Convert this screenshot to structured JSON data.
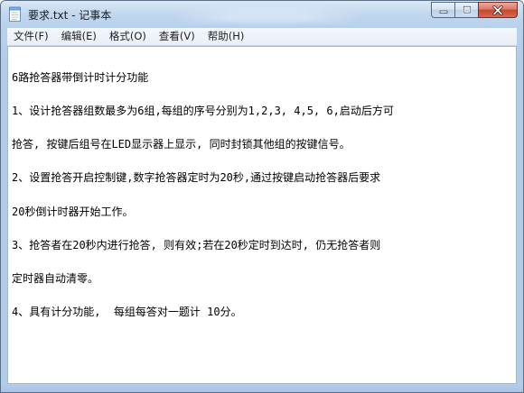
{
  "window": {
    "title": "要求.txt - 记事本",
    "icon": "notepad-icon",
    "controls": {
      "minimize_icon": "minimize-icon",
      "maximize_icon": "maximize-icon",
      "close_icon": "close-icon"
    }
  },
  "menu": [
    {
      "label": "文件(F)"
    },
    {
      "label": "编辑(E)"
    },
    {
      "label": "格式(O)"
    },
    {
      "label": "查看(V)"
    },
    {
      "label": "帮助(H)"
    }
  ],
  "editor": {
    "lines": [
      "6路抢答器带倒计时计分功能",
      "1、设计抢答器组数最多为6组,每组的序号分别为1,2,3, 4,5, 6,启动后方可",
      "抢答, 按键后组号在LED显示器上显示, 同时封锁其他组的按键信号。",
      "2、设置抢答开启控制键,数字抢答器定时为20秒,通过按键启动抢答器后要求",
      "20秒倒计时器开始工作。",
      "3、抢答者在20秒内进行抢答, 则有效;若在20秒定时到达时, 仍无抢答者则",
      "定时器自动清零。",
      "4、具有计分功能,  每组每答对一题计 10分。"
    ]
  },
  "colors": {
    "titlebar": "#c3d8ef",
    "close_button": "#c8452f",
    "editor_background": "#ffffff",
    "text": "#000000"
  }
}
